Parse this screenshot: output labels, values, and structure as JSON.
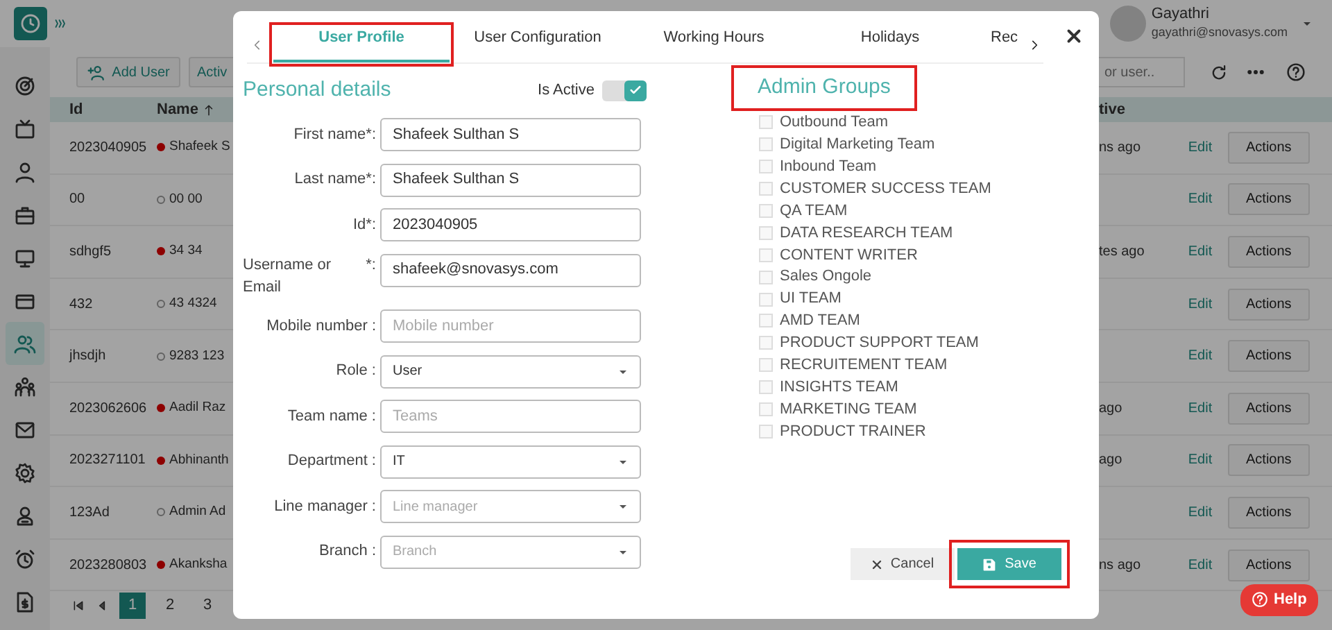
{
  "topbar": {
    "user": {
      "name": "Gayathri",
      "email": "gayathri@snovasys.com"
    }
  },
  "sidebar": {
    "items": [
      {
        "selected": false
      },
      {
        "selected": false
      },
      {
        "selected": false
      },
      {
        "selected": false
      },
      {
        "selected": false
      },
      {
        "selected": false
      },
      {
        "selected": true
      },
      {
        "selected": false
      },
      {
        "selected": false
      },
      {
        "selected": false
      },
      {
        "selected": false
      },
      {
        "selected": false
      },
      {
        "selected": false
      }
    ]
  },
  "toolbar": {
    "buttons": [
      "Add User",
      "Activ"
    ],
    "search": {
      "placeholder": "or user.."
    }
  },
  "table": {
    "columns": [
      "Id",
      "Name",
      "tive"
    ],
    "rows": [
      {
        "id": "2023040905",
        "filled": true,
        "name": "Shafeek S",
        "last_active": "ns ago",
        "edit": "Edit",
        "action": "Actions"
      },
      {
        "id": "00",
        "filled": false,
        "name": "00 00",
        "last_active": "",
        "edit": "Edit",
        "action": "Actions"
      },
      {
        "id": "sdhgf5",
        "filled": true,
        "name": "34 34",
        "last_active": "tes ago",
        "edit": "Edit",
        "action": "Actions"
      },
      {
        "id": "432",
        "filled": false,
        "name": "43 4324",
        "last_active": "",
        "edit": "Edit",
        "action": "Actions"
      },
      {
        "id": "jhsdjh",
        "filled": false,
        "name": "9283 123",
        "last_active": "",
        "edit": "Edit",
        "action": "Actions"
      },
      {
        "id": "2023062606",
        "filled": true,
        "name": "Aadil Raz",
        "last_active": "ago",
        "edit": "Edit",
        "action": "Actions"
      },
      {
        "id": "2023271101",
        "filled": true,
        "name": "Abhinanth",
        "last_active": "ago",
        "edit": "Edit",
        "action": "Actions"
      },
      {
        "id": "123Ad",
        "filled": false,
        "name": "Admin Ad",
        "last_active": "",
        "edit": "Edit",
        "action": "Actions"
      },
      {
        "id": "2023280803",
        "filled": true,
        "name": "Akanksha",
        "last_active": "ns ago",
        "edit": "Edit",
        "action": "Actions"
      }
    ]
  },
  "pagination": {
    "pages": [
      {
        "label": "1",
        "selected": true
      },
      {
        "label": "2",
        "selected": false
      },
      {
        "label": "3",
        "selected": false
      }
    ]
  },
  "help_button": "Help",
  "modal": {
    "tabs": [
      {
        "label": "User Profile",
        "selected": true,
        "highlighted": true
      },
      {
        "label": "User Configuration",
        "selected": false,
        "highlighted": false
      },
      {
        "label": "Working Hours",
        "selected": false,
        "highlighted": false
      },
      {
        "label": "Holidays",
        "selected": false,
        "highlighted": false
      },
      {
        "label": "Rec",
        "selected": false,
        "highlighted": false
      }
    ],
    "personal": {
      "title": "Personal details"
    },
    "is_active": {
      "label": "Is Active",
      "on": true
    },
    "fields": [
      {
        "kind": "text",
        "label": "First name*:",
        "value": "Shafeek Sulthan S"
      },
      {
        "kind": "text",
        "label": "Last name*:",
        "value": "Shafeek Sulthan S"
      },
      {
        "kind": "text",
        "label": "Id*:",
        "value": "2023040905"
      },
      {
        "kind": "text",
        "label": "Username or Email",
        "label_suffix": "*:",
        "value": "shafeek@snovasys.com"
      },
      {
        "kind": "text",
        "label": "Mobile number :",
        "placeholder": "Mobile number"
      },
      {
        "kind": "select",
        "label": "Role :",
        "value": "User"
      },
      {
        "kind": "text",
        "label": "Team name :",
        "placeholder": "Teams"
      },
      {
        "kind": "select",
        "label": "Department :",
        "value": "IT"
      },
      {
        "kind": "select",
        "label": "Line manager :",
        "placeholder": "Line manager"
      },
      {
        "kind": "select",
        "label": "Branch :",
        "placeholder": "Branch"
      }
    ],
    "admin_groups": {
      "title": "Admin Groups",
      "highlighted": true,
      "items": [
        {
          "label": "Outbound Team",
          "checked": false
        },
        {
          "label": "Digital Marketing Team",
          "checked": false
        },
        {
          "label": "Inbound Team",
          "checked": false
        },
        {
          "label": "CUSTOMER SUCCESS TEAM",
          "checked": false
        },
        {
          "label": "QA TEAM",
          "checked": false
        },
        {
          "label": "DATA RESEARCH TEAM",
          "checked": false
        },
        {
          "label": "CONTENT WRITER",
          "checked": false
        },
        {
          "label": "Sales Ongole",
          "checked": false
        },
        {
          "label": "UI TEAM",
          "checked": false
        },
        {
          "label": "AMD TEAM",
          "checked": false
        },
        {
          "label": "PRODUCT SUPPORT TEAM",
          "checked": false
        },
        {
          "label": "RECRUITEMENT TEAM",
          "checked": false
        },
        {
          "label": "INSIGHTS TEAM",
          "checked": false
        },
        {
          "label": "MARKETING TEAM",
          "checked": false
        },
        {
          "label": "PRODUCT TRAINER",
          "checked": false
        }
      ]
    },
    "buttons": [
      {
        "kind": "cancel",
        "label": "Cancel",
        "highlighted": false
      },
      {
        "kind": "save",
        "label": "Save",
        "highlighted": true
      }
    ]
  }
}
